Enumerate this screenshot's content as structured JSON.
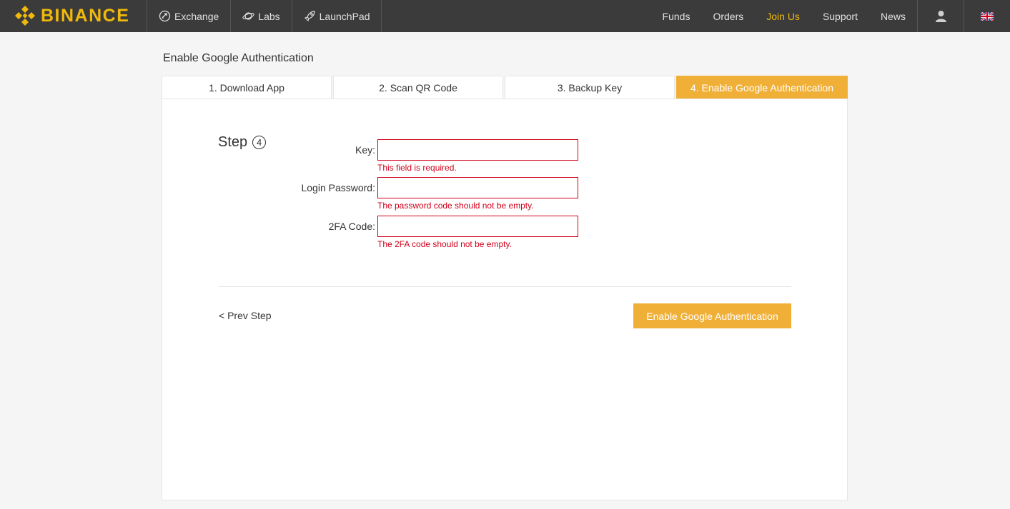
{
  "brand": {
    "name": "BINANCE",
    "color": "#f0b90b",
    "icon": "binance-logo-icon"
  },
  "nav": {
    "left": [
      {
        "label": "Exchange",
        "icon": "exchange-icon"
      },
      {
        "label": "Labs",
        "icon": "labs-planet-icon"
      },
      {
        "label": "LaunchPad",
        "icon": "rocket-icon"
      }
    ],
    "right": [
      {
        "label": "Funds"
      },
      {
        "label": "Orders"
      },
      {
        "label": "Join Us",
        "active": true
      },
      {
        "label": "Support"
      },
      {
        "label": "News"
      }
    ],
    "user_icon": "user-icon",
    "language_icon": "uk-flag-icon"
  },
  "page": {
    "title": "Enable Google Authentication",
    "tabs": [
      {
        "label": "1. Download App"
      },
      {
        "label": "2. Scan QR Code"
      },
      {
        "label": "3. Backup Key"
      },
      {
        "label": "4. Enable Google Authentication",
        "active": true
      }
    ],
    "step": {
      "label": "Step",
      "number": "4"
    },
    "fields": [
      {
        "label": "Key:",
        "value": "",
        "error": "This field is required."
      },
      {
        "label": "Login Password:",
        "value": "",
        "error": "The password code should not be empty."
      },
      {
        "label": "2FA Code:",
        "value": "",
        "error": "The 2FA code should not be empty."
      }
    ],
    "prev_step": "< Prev Step",
    "submit": "Enable Google Authentication"
  },
  "colors": {
    "accent": "#f0b038",
    "error": "#d0021b",
    "topbar": "#3b3b3b"
  }
}
